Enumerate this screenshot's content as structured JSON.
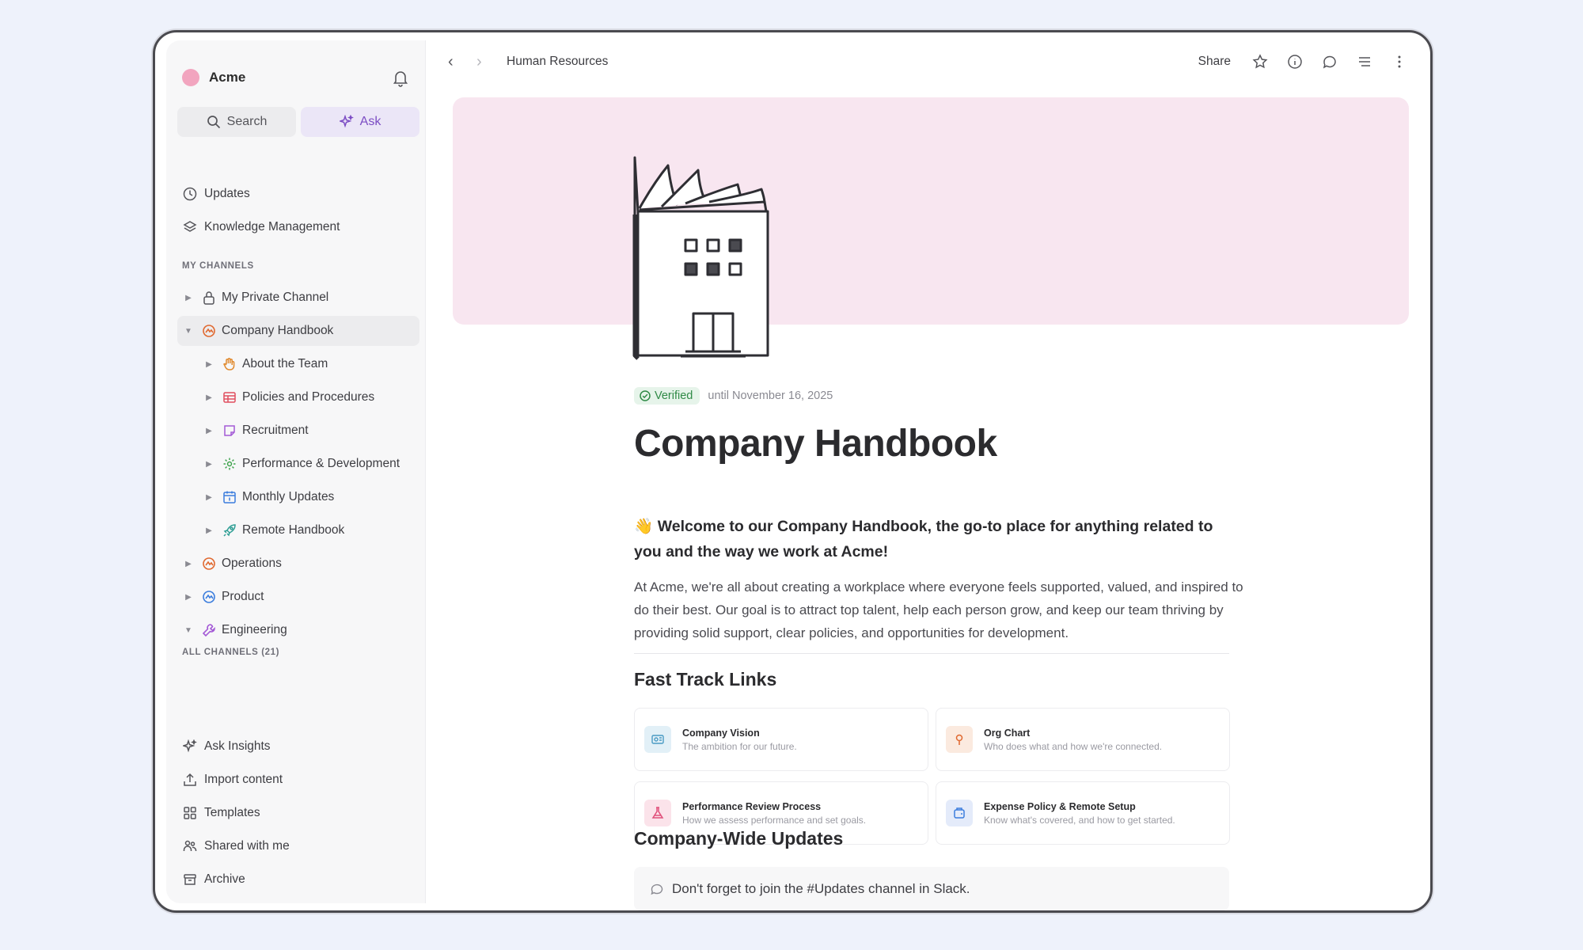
{
  "workspace": {
    "name": "Acme"
  },
  "sidebar": {
    "search_label": "Search",
    "ask_label": "Ask",
    "top_items": [
      {
        "label": "Updates",
        "icon": "clock-icon"
      },
      {
        "label": "Knowledge Management",
        "icon": "layers-icon"
      }
    ],
    "my_channels_label": "MY CHANNELS",
    "channels": [
      {
        "label": "My Private Channel",
        "icon": "lock-icon"
      },
      {
        "label": "Company Handbook",
        "icon": "handbook-icon"
      },
      {
        "label": "About the Team",
        "icon": "hand-icon"
      },
      {
        "label": "Policies and Procedures",
        "icon": "table-icon"
      },
      {
        "label": "Recruitment",
        "icon": "note-icon"
      },
      {
        "label": "Performance & Development",
        "icon": "gear-icon"
      },
      {
        "label": "Monthly Updates",
        "icon": "calendar-icon"
      },
      {
        "label": "Remote Handbook",
        "icon": "rocket-icon"
      },
      {
        "label": "Operations",
        "icon": "operations-icon"
      },
      {
        "label": "Product",
        "icon": "product-icon"
      },
      {
        "label": "Engineering",
        "icon": "wrench-icon"
      }
    ],
    "all_channels_label": "ALL CHANNELS (21)",
    "bottom_items": [
      {
        "label": "Ask Insights",
        "icon": "sparkle-icon"
      },
      {
        "label": "Import content",
        "icon": "upload-icon"
      },
      {
        "label": "Templates",
        "icon": "grid-icon"
      },
      {
        "label": "Shared with me",
        "icon": "users-icon"
      },
      {
        "label": "Archive",
        "icon": "archive-icon"
      }
    ]
  },
  "topbar": {
    "breadcrumb": "Human Resources",
    "share_label": "Share"
  },
  "page": {
    "verified_label": "Verified",
    "verified_until": "until November 16, 2025",
    "title": "Company Handbook",
    "lead_emoji": "👋",
    "lead": "Welcome to our Company Handbook, the go-to place for anything related to you and the way we work at Acme!",
    "paragraph": "At Acme, we're all about creating a workplace where everyone feels supported, valued, and inspired to do their best. Our goal is to attract top talent, help each person grow, and keep our team thriving by providing solid support, clear policies, and opportunities for development.",
    "fast_track_heading": "Fast Track Links",
    "links": [
      {
        "title": "Company Vision",
        "desc": "The ambition for our future."
      },
      {
        "title": "Org Chart",
        "desc": "Who does what and how we're connected."
      },
      {
        "title": "Performance Review Process",
        "desc": "How we assess performance and set goals."
      },
      {
        "title": "Expense Policy & Remote Setup",
        "desc": "Know what's covered, and how to get started."
      }
    ],
    "updates_heading": "Company-Wide Updates",
    "callout": "Don't forget to join the #Updates channel in Slack."
  },
  "colors": {
    "accent_purple": "#7c4dc4",
    "cover_pink": "#f8e6f0",
    "verified_green": "#2f8a46"
  }
}
